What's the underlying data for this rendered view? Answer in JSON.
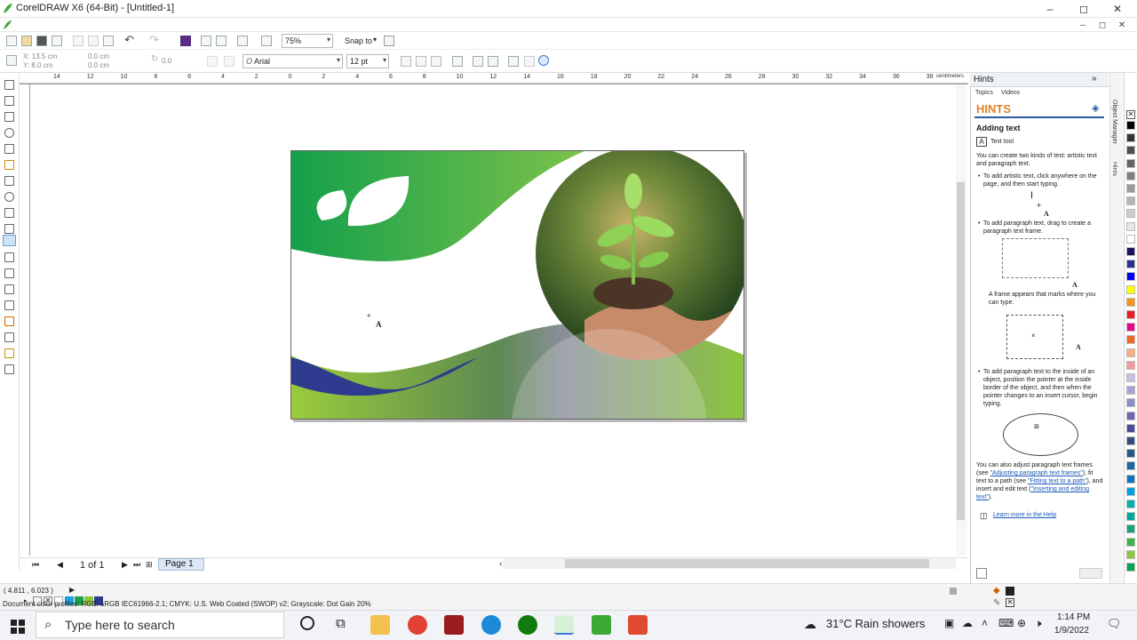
{
  "window": {
    "title": "CorelDRAW X6 (64-Bit) - [Untitled-1]",
    "minimize": "–",
    "maximize": "◻",
    "close": "✕"
  },
  "toolbar": {
    "zoom": "75%",
    "snap_to": "Snap to",
    "x_value": "X: 13.5 cm",
    "y_value": "Y: 8.0 cm",
    "w_value": "0.0 cm",
    "h_value": "0.0 cm",
    "rotation": "0.0",
    "font_name": "Arial",
    "font_size": "12 pt",
    "font_icon": "O"
  },
  "rulers": {
    "units": "centimeters",
    "top_ticks": [
      "14",
      "12",
      "10",
      "8",
      "6",
      "4",
      "2",
      "0",
      "2",
      "4",
      "6",
      "8",
      "10",
      "12",
      "14",
      "16",
      "18",
      "20",
      "22",
      "24",
      "26",
      "28",
      "30",
      "32",
      "34",
      "36",
      "38"
    ],
    "left_units": "centimeters"
  },
  "docnav": {
    "page_count": "1 of 1",
    "page_tab": "Page 1"
  },
  "hints": {
    "panel_title": "Hints",
    "tabs": [
      "Topics",
      "Videos"
    ],
    "heading": "HINTS",
    "section_title": "Adding text",
    "tool_label": "Text tool",
    "intro": "You can create two kinds of text: artistic text and paragraph text.",
    "bullet1": "To add artistic text, click anywhere on the page, and then start typing.",
    "bullet2": "To add paragraph text, drag to create a paragraph text frame.",
    "frame_note": "A frame appears that marks where you can type.",
    "bullet3": "To add paragraph text to the inside of an object, position the pointer at the inside border of the object, and then when the pointer changes to an insert cursor, begin typing.",
    "adjust_1": "You can also adjust paragraph text frames (see ",
    "adjust_link1": "\"Adjusting paragraph text frames\"",
    "adjust_2": "), fit text to a path (see ",
    "adjust_link2": "\"Fitting text to a path\"",
    "adjust_3": "), and insert and edit text (",
    "adjust_link3": "\"Inserting and editing text\"",
    "adjust_4": ").",
    "learn_more": "Learn more in the Help",
    "side_tabs": [
      "Object Manager",
      "Hints"
    ]
  },
  "status": {
    "coords": "( 4.811 , 6.023 )",
    "profiles": "Document color profiles: RGB: sRGB IEC61966-2.1; CMYK: U.S. Web Coated (SWOP) v2; Grayscale: Dot Gain 20%"
  },
  "taskbar": {
    "search_placeholder": "Type here to search",
    "weather": "31°C  Rain showers",
    "time": "1:14 PM",
    "date": "1/9/2022"
  },
  "colors": {
    "green_dark": "#1aa24a",
    "green_light": "#8cc63f",
    "navy": "#2e3b8f",
    "hints_orange": "#d9822b",
    "link": "#1a5ab8"
  },
  "palette_colors": [
    "#000000",
    "#333333",
    "#4d4d4d",
    "#666666",
    "#808080",
    "#999999",
    "#b3b3b3",
    "#cccccc",
    "#e6e6e6",
    "#ffffff",
    "#1b1464",
    "#2e3192",
    "#0000ff",
    "#ffff00",
    "#f7941d",
    "#ed1c24",
    "#ec008c",
    "#f26522",
    "#f9ad81",
    "#f6989d",
    "#c2c2e8",
    "#a3a3d6",
    "#8c8cc7",
    "#6a6ab4",
    "#4a4aa0",
    "#334c80",
    "#26598c",
    "#1a66a6",
    "#0d73bf",
    "#00a0e0",
    "#00b3b3",
    "#00a99d",
    "#1aa280",
    "#39b54a",
    "#8dc63f",
    "#00a651"
  ]
}
